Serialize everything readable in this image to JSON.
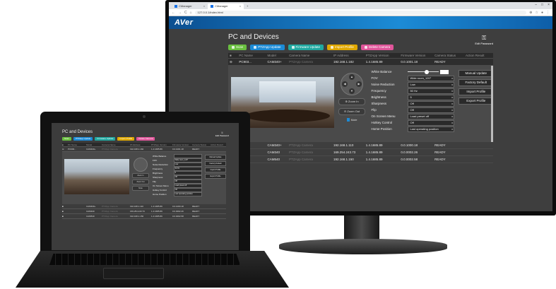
{
  "browser": {
    "tab_label": "CManager",
    "new_tab": "+",
    "url": "127.0.0.1/index.html",
    "window_controls": [
      "–",
      "□",
      "×"
    ]
  },
  "app": {
    "logo": "AVer",
    "page_title": "PC and Devices",
    "edit_password": "Edit Password"
  },
  "toolbar": [
    {
      "label": "Scan",
      "color": "#6abf40"
    },
    {
      "label": "PTZApp Update",
      "color": "#1c8bd6"
    },
    {
      "label": "Firmware Update",
      "color": "#20a8a0"
    },
    {
      "label": "Import Profile",
      "color": "#e0a800"
    },
    {
      "label": "Delete Camera",
      "color": "#e0559a"
    }
  ],
  "table": {
    "headers": [
      "",
      "PC Name",
      "Model",
      "Camera Name",
      "IP Address",
      "PTZApp Version",
      "Firmware Version",
      "Camera Status",
      "Action Result"
    ],
    "selected_row": [
      "",
      "PC903...",
      "CAM340+",
      "PTZApp Camera",
      "192.168.1.182",
      "1.4.1685.89",
      "0.0.1001.18",
      "READY",
      ""
    ],
    "rows": [
      [
        "",
        "",
        "CAM340+",
        "PTZApp Camera",
        "192.168.1.110",
        "1.4.1685.89",
        "0.0.1000.18",
        "READY",
        ""
      ],
      [
        "",
        "",
        "CAM340",
        "PTZApp Camera",
        "169.254.243.73",
        "1.4.1685.89",
        "0.0.0002.26",
        "READY",
        ""
      ],
      [
        "",
        "",
        "CAM540",
        "PTZApp Camera",
        "192.168.1.150",
        "1.4.1685.89",
        "0.0.0002.58",
        "READY",
        ""
      ]
    ]
  },
  "ptz": {
    "zoom_in": "Zoom In",
    "zoom_out": "Zoom Out",
    "mute": "Mute"
  },
  "settings": [
    {
      "label": "White Balance",
      "value": ""
    },
    {
      "label": "FOV",
      "value": "Wide room_120°"
    },
    {
      "label": "Noise Reduction",
      "value": "Low"
    },
    {
      "label": "Frequency",
      "value": "50 Hz"
    },
    {
      "label": "Brightness",
      "value": "5"
    },
    {
      "label": "Sharpness",
      "value": "Off"
    },
    {
      "label": "Flip",
      "value": "Off"
    },
    {
      "label": "On Screen Menu",
      "value": "Load preset off"
    },
    {
      "label": "Hotkey Control",
      "value": "Off"
    },
    {
      "label": "Home Position",
      "value": "Last operating position"
    }
  ],
  "actions": [
    "Manual Update",
    "Factory Default",
    "Import Profile",
    "Export Profile"
  ]
}
